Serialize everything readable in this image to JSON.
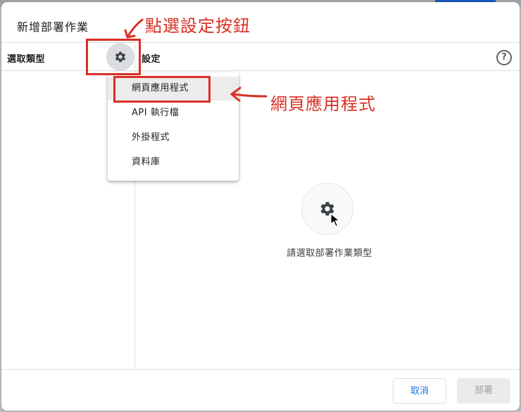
{
  "dialog": {
    "title": "新增部署作業",
    "left_label": "選取類型",
    "right_label": "設定",
    "help_glyph": "?"
  },
  "menu": {
    "items": [
      {
        "label": "網頁應用程式",
        "selected": true
      },
      {
        "label": "API 執行檔",
        "selected": false
      },
      {
        "label": "外掛程式",
        "selected": false
      },
      {
        "label": "資料庫",
        "selected": false
      }
    ]
  },
  "empty_state": {
    "text": "請選取部署作業類型",
    "icon": "gear-icon"
  },
  "footer": {
    "cancel_label": "取消",
    "deploy_label": "部署"
  },
  "annotations": {
    "gear_callout": "點選設定按鈕",
    "menu_callout": "網頁應用程式",
    "color": "#d93025"
  },
  "colors": {
    "accent": "#1a73e8",
    "annotation": "#d93025"
  }
}
